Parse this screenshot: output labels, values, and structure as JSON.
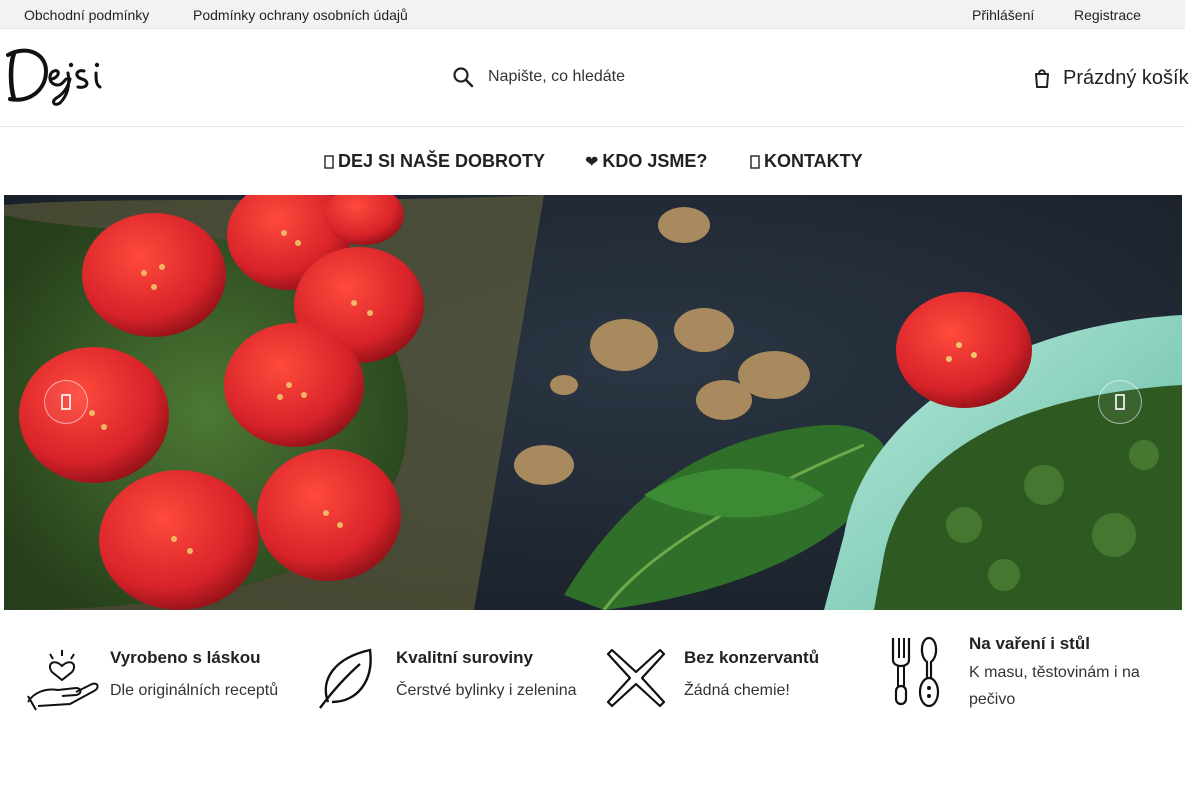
{
  "topbar": {
    "left_links": [
      "Obchodní podmínky",
      "Podmínky ochrany osobních údajů"
    ],
    "right_links": [
      "Přihlášení",
      "Registrace"
    ]
  },
  "header": {
    "logo_text": "Dejsi",
    "search": {
      "placeholder": "Napište, co hledáte",
      "icon": "search-icon"
    },
    "cart": {
      "label": "Prázdný košík",
      "icon": "cart-icon"
    }
  },
  "nav": {
    "items": [
      {
        "label": "DEJ SI NAŠE DOBROTY",
        "icon": "list-icon"
      },
      {
        "label": "KDO JSME?",
        "icon": "heart-icon",
        "glyph": "❤"
      },
      {
        "label": "KONTAKTY",
        "icon": "phone-icon"
      }
    ]
  },
  "hero": {
    "prev_icon": "chevron-left-icon",
    "next_icon": "chevron-right-icon"
  },
  "features": [
    {
      "title": "Vyrobeno s láskou",
      "subtitle": "Dle originálních receptů",
      "icon": "heart-hand-icon"
    },
    {
      "title": "Kvalitní suroviny",
      "subtitle": "Čerstvé bylinky i zelenina",
      "icon": "leaf-icon"
    },
    {
      "title": "Bez konzervantů",
      "subtitle": "Žádná chemie!",
      "icon": "cross-icon"
    },
    {
      "title": "Na vaření i stůl",
      "subtitle": "K masu, těstovinám i na pečivo",
      "icon": "cutlery-icon"
    }
  ],
  "colors": {
    "topbar_bg": "#f2f2f2",
    "text": "#222222",
    "hero_bg": "#1e2630",
    "tomato": "#d8232a",
    "pesto": "#3e6a2a",
    "dish": "#86d3bf"
  }
}
